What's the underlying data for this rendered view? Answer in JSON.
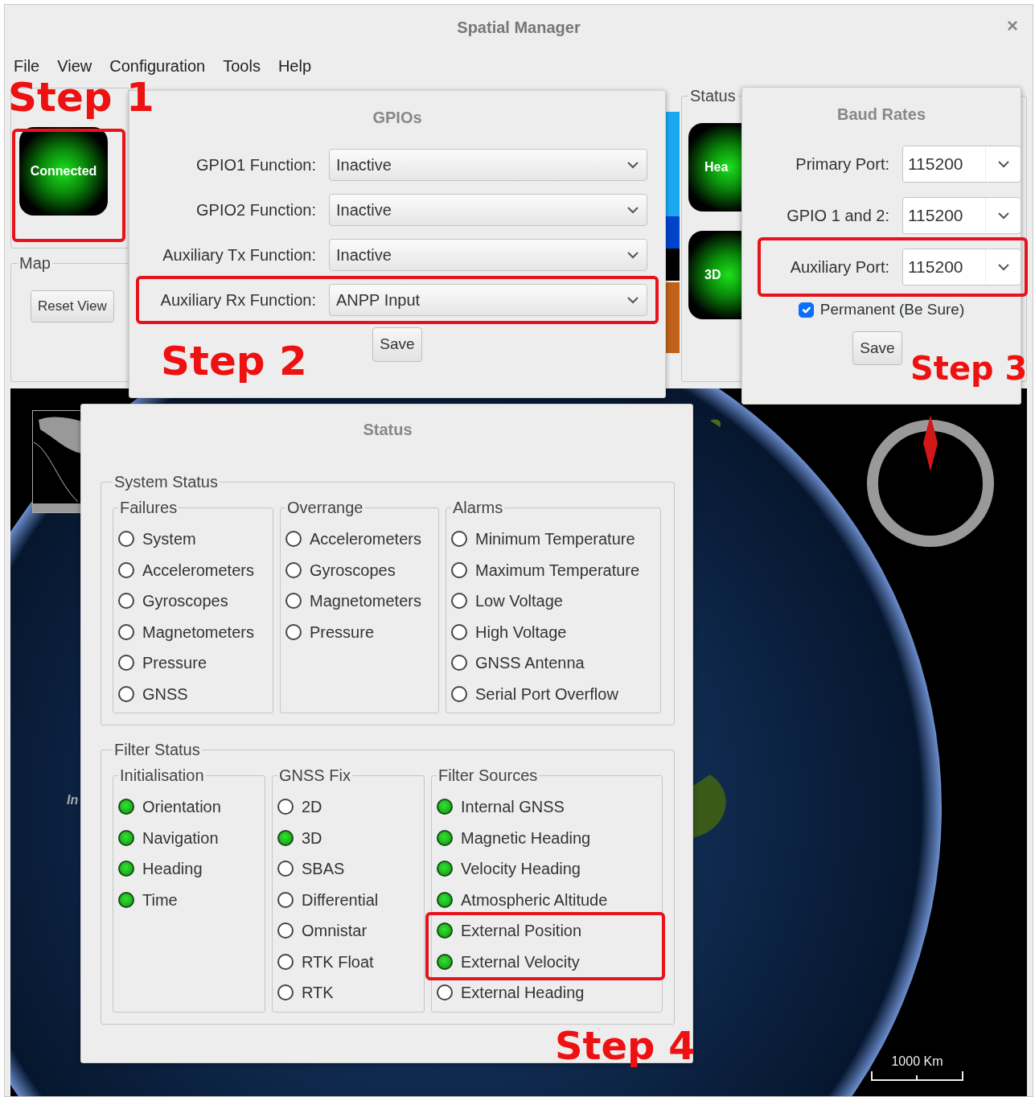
{
  "window": {
    "title": "Spatial Manager",
    "close": "×"
  },
  "menu": [
    "File",
    "View",
    "Configuration",
    "Tools",
    "Help"
  ],
  "serial_port": {
    "indicator": {
      "label": "Connected",
      "on": true
    }
  },
  "map_group": {
    "title": "Map",
    "button": "Reset View"
  },
  "status_group": {
    "title": "Status",
    "indicators": [
      {
        "label": "Hea",
        "on": true
      },
      {
        "label": "3D",
        "on": true
      }
    ]
  },
  "map_view": {
    "partial_label": "In",
    "scale": "1000 Km"
  },
  "gpio_dialog": {
    "title": "GPIOs",
    "rows": [
      {
        "label": "GPIO1 Function:",
        "value": "Inactive",
        "highlighted": false
      },
      {
        "label": "GPIO2 Function:",
        "value": "Inactive",
        "highlighted": false
      },
      {
        "label": "Auxiliary Tx Function:",
        "value": "Inactive",
        "highlighted": false
      },
      {
        "label": "Auxiliary Rx Function:",
        "value": "ANPP Input",
        "highlighted": true
      }
    ],
    "save": "Save"
  },
  "baud_dialog": {
    "title": "Baud Rates",
    "rows": [
      {
        "label": "Primary Port:",
        "value": "115200",
        "highlighted": false
      },
      {
        "label": "GPIO 1 and 2:",
        "value": "115200",
        "highlighted": false
      },
      {
        "label": "Auxiliary Port:",
        "value": "115200",
        "highlighted": true
      }
    ],
    "permanent": {
      "label": "Permanent (Be Sure)",
      "checked": true
    },
    "save": "Save"
  },
  "status_dialog": {
    "title": "Status",
    "sections": [
      {
        "title": "System Status",
        "groups": [
          {
            "title": "Failures",
            "items": [
              {
                "label": "System",
                "on": false
              },
              {
                "label": "Accelerometers",
                "on": false
              },
              {
                "label": "Gyroscopes",
                "on": false
              },
              {
                "label": "Magnetometers",
                "on": false
              },
              {
                "label": "Pressure",
                "on": false
              },
              {
                "label": "GNSS",
                "on": false
              }
            ]
          },
          {
            "title": "Overrange",
            "items": [
              {
                "label": "Accelerometers",
                "on": false
              },
              {
                "label": "Gyroscopes",
                "on": false
              },
              {
                "label": "Magnetometers",
                "on": false
              },
              {
                "label": "Pressure",
                "on": false
              }
            ]
          },
          {
            "title": "Alarms",
            "items": [
              {
                "label": "Minimum Temperature",
                "on": false
              },
              {
                "label": "Maximum Temperature",
                "on": false
              },
              {
                "label": "Low Voltage",
                "on": false
              },
              {
                "label": "High Voltage",
                "on": false
              },
              {
                "label": "GNSS Antenna",
                "on": false
              },
              {
                "label": "Serial Port Overflow",
                "on": false
              }
            ]
          }
        ]
      },
      {
        "title": "Filter Status",
        "groups": [
          {
            "title": "Initialisation",
            "items": [
              {
                "label": "Orientation",
                "on": true
              },
              {
                "label": "Navigation",
                "on": true
              },
              {
                "label": "Heading",
                "on": true
              },
              {
                "label": "Time",
                "on": true
              }
            ]
          },
          {
            "title": "GNSS Fix",
            "items": [
              {
                "label": "2D",
                "on": false
              },
              {
                "label": "3D",
                "on": true
              },
              {
                "label": "SBAS",
                "on": false
              },
              {
                "label": "Differential",
                "on": false
              },
              {
                "label": "Omnistar",
                "on": false
              },
              {
                "label": "RTK Float",
                "on": false
              },
              {
                "label": "RTK",
                "on": false
              }
            ]
          },
          {
            "title": "Filter Sources",
            "items": [
              {
                "label": "Internal GNSS",
                "on": true
              },
              {
                "label": "Magnetic Heading",
                "on": true
              },
              {
                "label": "Velocity Heading",
                "on": true
              },
              {
                "label": "Atmospheric Altitude",
                "on": true
              },
              {
                "label": "External Position",
                "on": true
              },
              {
                "label": "External Velocity",
                "on": true
              },
              {
                "label": "External Heading",
                "on": false
              }
            ]
          }
        ]
      }
    ]
  },
  "annotations": [
    "Step 1",
    "Step 2",
    "Step 3",
    "Step 4"
  ]
}
